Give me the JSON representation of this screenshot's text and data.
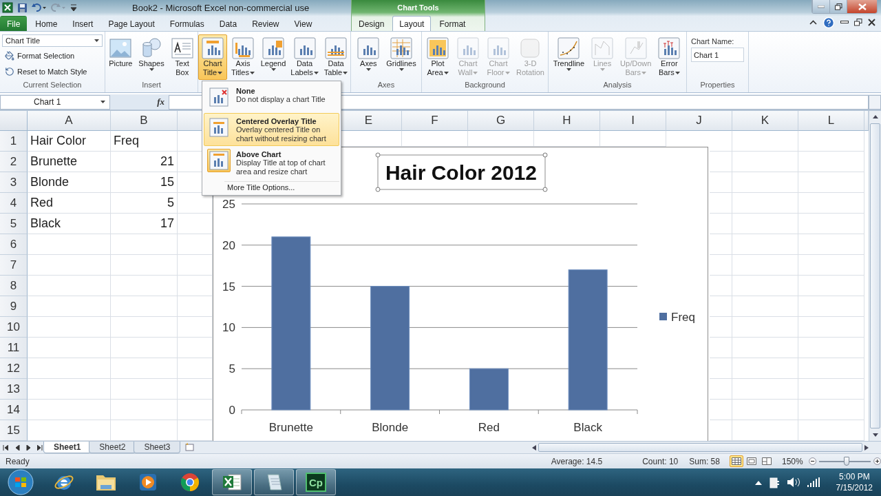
{
  "window": {
    "title": "Book2  -  Microsoft Excel non-commercial use",
    "context_group": "Chart Tools"
  },
  "ribbon_tabs": [
    {
      "label": "File",
      "kind": "file",
      "selected": false
    },
    {
      "label": "Home",
      "kind": "main",
      "selected": false
    },
    {
      "label": "Insert",
      "kind": "main",
      "selected": false
    },
    {
      "label": "Page Layout",
      "kind": "main",
      "selected": false
    },
    {
      "label": "Formulas",
      "kind": "main",
      "selected": false
    },
    {
      "label": "Data",
      "kind": "main",
      "selected": false
    },
    {
      "label": "Review",
      "kind": "main",
      "selected": false
    },
    {
      "label": "View",
      "kind": "main",
      "selected": false
    },
    {
      "label": "Design",
      "kind": "context",
      "selected": false
    },
    {
      "label": "Layout",
      "kind": "context",
      "selected": true
    },
    {
      "label": "Format",
      "kind": "context",
      "selected": false
    }
  ],
  "ribbon_groups": [
    {
      "kind": "selection",
      "label": "Current Selection",
      "dropdown": "Chart Title",
      "items": [
        "Format Selection",
        "Reset to Match Style"
      ]
    },
    {
      "kind": "buttons",
      "label": "Insert",
      "buttons": [
        {
          "kind": "picture",
          "lines": [
            "Picture"
          ],
          "dropdown": false,
          "pressed": false,
          "disabled": false
        },
        {
          "kind": "shapes",
          "lines": [
            "Shapes"
          ],
          "dropdown": true,
          "pressed": false,
          "disabled": false
        },
        {
          "kind": "textbox",
          "lines": [
            "Text",
            "Box"
          ],
          "dropdown": false,
          "pressed": false,
          "disabled": false
        }
      ]
    },
    {
      "kind": "buttons",
      "buttons": [
        {
          "kind": "title",
          "lines": [
            "Chart",
            "Title"
          ],
          "dropdown": true,
          "pressed": true,
          "disabled": false
        },
        {
          "kind": "axistitle",
          "lines": [
            "Axis",
            "Titles"
          ],
          "dropdown": true,
          "pressed": false,
          "disabled": false
        },
        {
          "kind": "legend",
          "lines": [
            "Legend"
          ],
          "dropdown": true,
          "pressed": false,
          "disabled": false
        },
        {
          "kind": "chart",
          "lines": [
            "Data",
            "Labels"
          ],
          "dropdown": true,
          "pressed": false,
          "disabled": false
        },
        {
          "kind": "table",
          "lines": [
            "Data",
            "Table"
          ],
          "dropdown": true,
          "pressed": false,
          "disabled": false
        }
      ]
    },
    {
      "kind": "buttons",
      "label": "Axes",
      "buttons": [
        {
          "kind": "chart",
          "lines": [
            "Axes"
          ],
          "dropdown": true,
          "pressed": false,
          "disabled": false
        },
        {
          "kind": "grid",
          "lines": [
            "Gridlines"
          ],
          "dropdown": true,
          "pressed": false,
          "disabled": false
        }
      ]
    },
    {
      "kind": "buttons",
      "label": "Background",
      "buttons": [
        {
          "kind": "plot",
          "lines": [
            "Plot",
            "Area"
          ],
          "dropdown": true,
          "pressed": false,
          "disabled": false
        },
        {
          "kind": "chart",
          "lines": [
            "Chart",
            "Wall"
          ],
          "dropdown": true,
          "pressed": false,
          "disabled": true
        },
        {
          "kind": "chart",
          "lines": [
            "Chart",
            "Floor"
          ],
          "dropdown": true,
          "pressed": false,
          "disabled": true
        },
        {
          "kind": "cube",
          "lines": [
            "3-D",
            "Rotation"
          ],
          "dropdown": false,
          "pressed": false,
          "disabled": true
        }
      ]
    },
    {
      "kind": "buttons",
      "label": "Analysis",
      "buttons": [
        {
          "kind": "trend",
          "lines": [
            "Trendline"
          ],
          "dropdown": true,
          "pressed": false,
          "disabled": false
        },
        {
          "kind": "lines",
          "lines": [
            "Lines"
          ],
          "dropdown": true,
          "pressed": false,
          "disabled": true
        },
        {
          "kind": "updown",
          "lines": [
            "Up/Down",
            "Bars"
          ],
          "dropdown": true,
          "pressed": false,
          "disabled": true
        },
        {
          "kind": "errorbars",
          "lines": [
            "Error",
            "Bars"
          ],
          "dropdown": true,
          "pressed": false,
          "disabled": false
        }
      ]
    },
    {
      "kind": "properties",
      "label": "Properties",
      "field_label": "Chart Name:",
      "value": "Chart 1"
    }
  ],
  "title_menu": {
    "items": [
      {
        "kind": "option",
        "title": "None",
        "description": [
          "Do not display a chart Title"
        ],
        "hovered": false,
        "selected": false
      },
      {
        "kind": "option",
        "title": "Centered Overlay Title",
        "description": [
          "Overlay centered Title on",
          "chart without resizing chart"
        ],
        "hovered": true,
        "selected": false
      },
      {
        "kind": "option",
        "title": "Above Chart",
        "description": [
          "Display Title at top of chart",
          "area and resize chart"
        ],
        "hovered": false,
        "selected": true
      },
      {
        "kind": "link",
        "title": "More Title Options..."
      }
    ]
  },
  "formula_bar": {
    "name_box": "Chart 1",
    "function_button": "fx"
  },
  "columns": [
    {
      "kind": "letter",
      "label": "A"
    },
    {
      "kind": "letter",
      "label": "B"
    },
    {
      "kind": "blank"
    },
    {
      "kind": "blank"
    },
    {
      "kind": "letter",
      "label": "E"
    },
    {
      "kind": "letter",
      "label": "F"
    },
    {
      "kind": "letter",
      "label": "G"
    },
    {
      "kind": "letter",
      "label": "H"
    },
    {
      "kind": "letter",
      "label": "I"
    },
    {
      "kind": "letter",
      "label": "J"
    },
    {
      "kind": "letter",
      "label": "K"
    },
    {
      "kind": "letter",
      "label": "L"
    }
  ],
  "rows": [
    {
      "number": "1",
      "cells": [
        {
          "kind": "text",
          "text": "Hair Color"
        },
        {
          "kind": "text",
          "text": "Freq"
        }
      ]
    },
    {
      "number": "2",
      "cells": [
        {
          "kind": "text",
          "text": "Brunette"
        },
        {
          "kind": "number",
          "text": "21"
        }
      ]
    },
    {
      "number": "3",
      "cells": [
        {
          "kind": "text",
          "text": "Blonde"
        },
        {
          "kind": "number",
          "text": "15"
        }
      ]
    },
    {
      "number": "4",
      "cells": [
        {
          "kind": "text",
          "text": "Red"
        },
        {
          "kind": "number",
          "text": "5"
        }
      ]
    },
    {
      "number": "5",
      "cells": [
        {
          "kind": "text",
          "text": "Black"
        },
        {
          "kind": "number",
          "text": "17"
        }
      ]
    },
    {
      "number": "6"
    },
    {
      "number": "7"
    },
    {
      "number": "8"
    },
    {
      "number": "9"
    },
    {
      "number": "10"
    },
    {
      "number": "11"
    },
    {
      "number": "12"
    },
    {
      "number": "13"
    },
    {
      "number": "14"
    },
    {
      "number": "15"
    }
  ],
  "chart": {
    "title_selected": true,
    "chart_data": {
      "type": "bar",
      "title": "Hair Color 2012",
      "categories": [
        "Brunette",
        "Blonde",
        "Red",
        "Black"
      ],
      "series": [
        {
          "name": "Freq",
          "color": "#4f6fa0",
          "values": [
            21,
            15,
            5,
            17
          ]
        }
      ],
      "ylim": [
        0,
        25
      ],
      "yticks": [
        0,
        5,
        10,
        15,
        20,
        25
      ],
      "grid": true
    }
  },
  "sheet_tabs": [
    {
      "label": "Sheet1",
      "selected": true
    },
    {
      "label": "Sheet2",
      "selected": false
    },
    {
      "label": "Sheet3",
      "selected": false
    }
  ],
  "status_bar": {
    "mode": "Ready",
    "average": "Average: 14.5",
    "count": "Count: 10",
    "sum": "Sum: 58",
    "views": [
      {
        "kind": "normal",
        "selected": true
      },
      {
        "kind": "layout",
        "selected": false
      },
      {
        "kind": "pagebreak",
        "selected": false
      }
    ],
    "zoom": "150%",
    "zoom_slider": {
      "level": 0.53
    }
  },
  "taskbar": {
    "apps": [
      {
        "kind": "browser",
        "running": false
      },
      {
        "kind": "folder",
        "running": false
      },
      {
        "kind": "media",
        "running": false
      },
      {
        "kind": "chrome",
        "running": false
      },
      {
        "kind": "excel",
        "running": true
      },
      {
        "kind": "notepad",
        "running": true
      },
      {
        "kind": "cp",
        "running": true,
        "label": "Cp"
      }
    ],
    "time": "5:00 PM",
    "date": "7/15/2012"
  }
}
